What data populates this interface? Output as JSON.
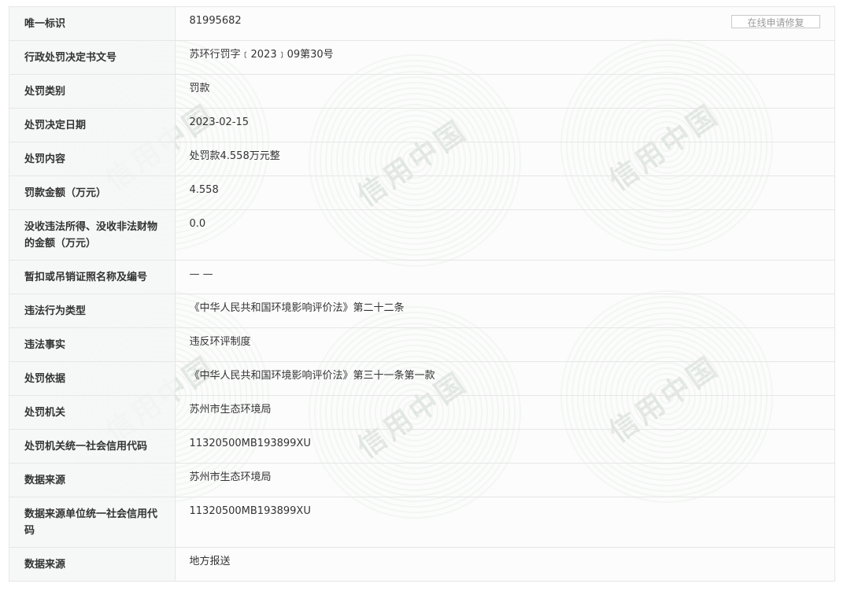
{
  "watermark_text": "信用中国",
  "repair_button_label": "在线申请修复",
  "rows": [
    {
      "label": "唯一标识",
      "value": "81995682"
    },
    {
      "label": "行政处罚决定书文号",
      "value": "苏环行罚字﹝2023﹞09第30号"
    },
    {
      "label": "处罚类别",
      "value": "罚款"
    },
    {
      "label": "处罚决定日期",
      "value": "2023-02-15"
    },
    {
      "label": "处罚内容",
      "value": "处罚款4.558万元整"
    },
    {
      "label": "罚款金额（万元）",
      "value": "4.558"
    },
    {
      "label": "没收违法所得、没收非法财物的金额（万元）",
      "value": "0.0"
    },
    {
      "label": "暂扣或吊销证照名称及编号",
      "value": "— —"
    },
    {
      "label": "违法行为类型",
      "value": "《中华人民共和国环境影响评价法》第二十二条"
    },
    {
      "label": "违法事实",
      "value": "违反环评制度"
    },
    {
      "label": "处罚依据",
      "value": "《中华人民共和国环境影响评价法》第三十一条第一款"
    },
    {
      "label": "处罚机关",
      "value": "苏州市生态环境局"
    },
    {
      "label": "处罚机关统一社会信用代码",
      "value": "11320500MB193899XU"
    },
    {
      "label": "数据来源",
      "value": "苏州市生态环境局"
    },
    {
      "label": "数据来源单位统一社会信用代码",
      "value": "11320500MB193899XU"
    },
    {
      "label": "数据来源",
      "value": "地方报送"
    }
  ]
}
